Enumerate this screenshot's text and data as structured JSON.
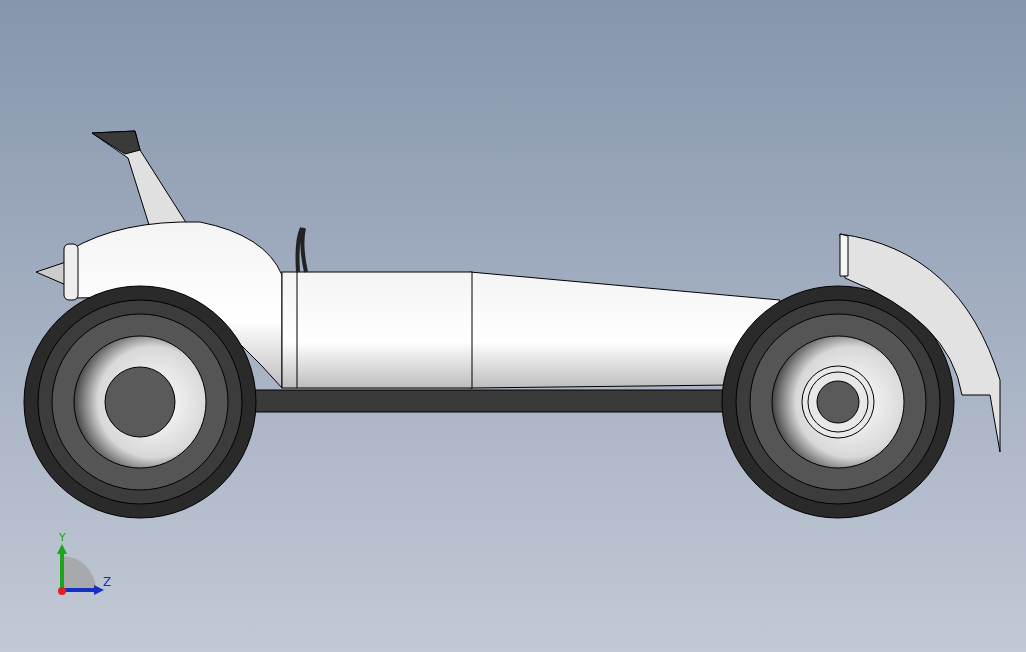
{
  "viewport": {
    "model": {
      "kind": "car"
    },
    "triad": {
      "y_label": "Y",
      "z_label": "Z"
    }
  }
}
